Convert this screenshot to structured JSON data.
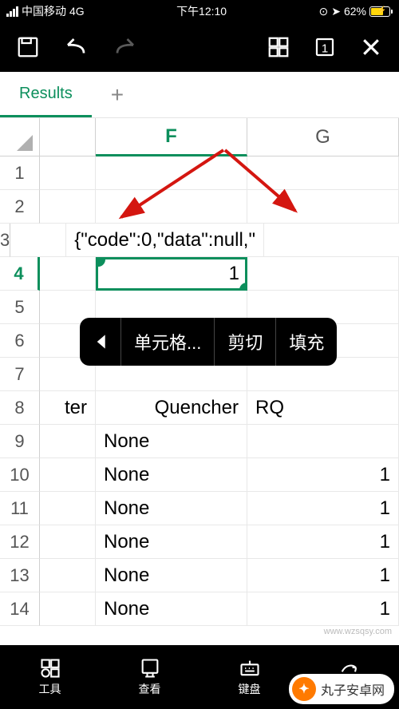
{
  "status": {
    "carrier": "中国移动",
    "network": "4G",
    "time": "下午12:10",
    "battery_pct": "62%"
  },
  "tabs": {
    "results": "Results"
  },
  "columns": [
    "F",
    "G"
  ],
  "rows": [
    {
      "n": "1",
      "e": "",
      "f": "",
      "g": ""
    },
    {
      "n": "2",
      "e": "",
      "f": "",
      "g": ""
    },
    {
      "n": "3",
      "e": "",
      "f": "{\"code\":0,\"data\":null,\"",
      "g": ""
    },
    {
      "n": "4",
      "e": "",
      "f": "1",
      "g": ""
    },
    {
      "n": "5",
      "e": "",
      "f": "",
      "g": ""
    },
    {
      "n": "6",
      "e": "",
      "f": "",
      "g": ""
    },
    {
      "n": "7",
      "e": "",
      "f": "",
      "g": ""
    },
    {
      "n": "8",
      "e": "ter",
      "f": "Quencher",
      "g": "RQ"
    },
    {
      "n": "9",
      "e": "",
      "f": "None",
      "g": ""
    },
    {
      "n": "10",
      "e": "",
      "f": "None",
      "g": "1"
    },
    {
      "n": "11",
      "e": "",
      "f": "None",
      "g": "1"
    },
    {
      "n": "12",
      "e": "",
      "f": "None",
      "g": "1"
    },
    {
      "n": "13",
      "e": "",
      "f": "None",
      "g": "1"
    },
    {
      "n": "14",
      "e": "",
      "f": "None",
      "g": "1"
    }
  ],
  "active_row": "4",
  "context_menu": {
    "cell_more": "单元格...",
    "cut": "剪切",
    "fill": "填充"
  },
  "bottom": {
    "tools": "工具",
    "view": "查看",
    "keyboard": "键盘"
  },
  "watermark": "www.wzsqsy.com",
  "logo_text": "丸子安卓网",
  "colors": {
    "accent": "#0c8f5c",
    "arrow": "#d41610"
  }
}
